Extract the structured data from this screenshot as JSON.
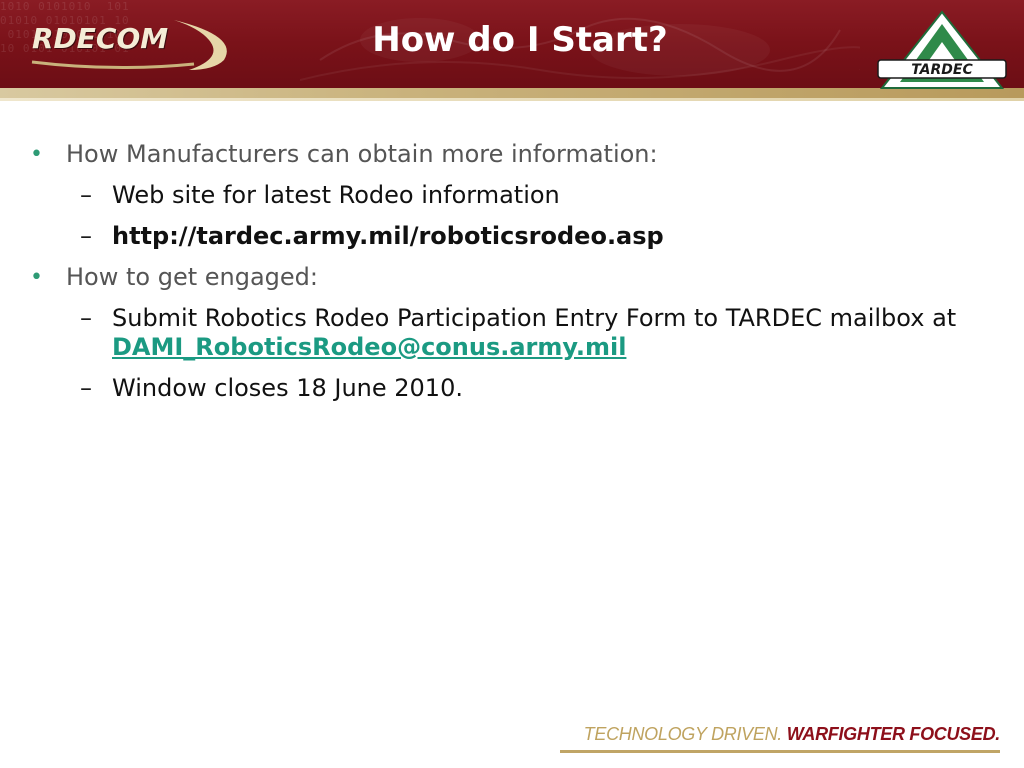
{
  "header": {
    "title": "How do I Start?",
    "left_logo_text": "RDECOM",
    "right_logo_text": "TARDEC"
  },
  "bullets": [
    {
      "text": "How Manufacturers can obtain more information:",
      "subitems": [
        {
          "text": "Web site for latest Rodeo information"
        },
        {
          "text": "http://tardec.army.mil/roboticsrodeo.asp"
        }
      ]
    },
    {
      "text": "How to get engaged:",
      "subitems": [
        {
          "text": "Submit Robotics Rodeo Participation Entry Form to TARDEC mailbox at",
          "link": "DAMI_RoboticsRodeo@conus.army.mil"
        },
        {
          "text": "Window closes 18 June 2010."
        }
      ]
    }
  ],
  "footer": {
    "tagline_part1": "TECHNOLOGY DRIVEN.",
    "tagline_part2": "WARFIGHTER FOCUSED."
  },
  "colors": {
    "header_maroon": "#7a1219",
    "gold": "#c9b27c",
    "bullet_green": "#2e9b75",
    "link_teal": "#1b9a82",
    "tagline_gold": "#bfa35f",
    "tagline_red": "#8d0f1a"
  },
  "icons": {
    "bullet": "round-bullet",
    "subbullet": "en-dash"
  }
}
